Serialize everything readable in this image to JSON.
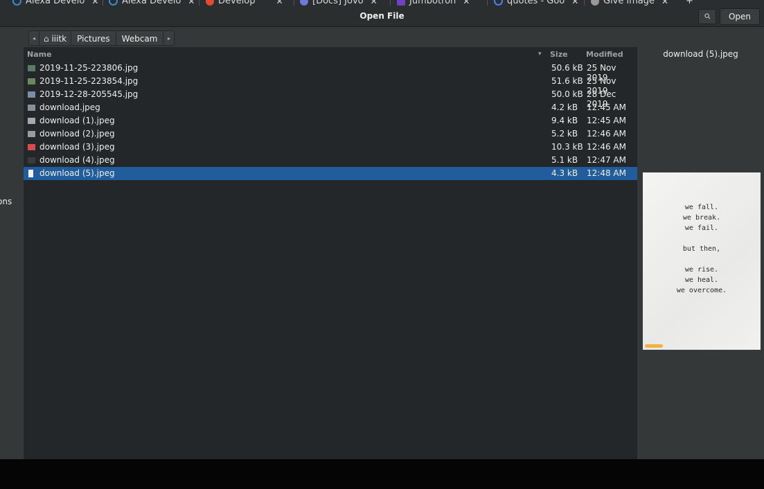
{
  "browser_tabs": [
    {
      "label": "Alexa Develo",
      "icon_color": "#2f8fd8"
    },
    {
      "label": "Alexa Develo",
      "icon_color": "#2f8fd8"
    },
    {
      "label": "Develop",
      "icon_color": "#e44a2e"
    },
    {
      "label": "[Docs] Jovo",
      "icon_color": "#6c7bd8"
    },
    {
      "label": "Jumbotron",
      "icon_color": "#6f42c1"
    },
    {
      "label": "quotes - Goo",
      "icon_color": "#4285f4"
    },
    {
      "label": "Give image",
      "icon_color": "#999999"
    }
  ],
  "dialog": {
    "title": "Open File",
    "search_icon": "search-icon",
    "open_label": "Open"
  },
  "sidebar": {
    "partial_label": "ons"
  },
  "pathbar": {
    "back_arrow": "◂",
    "home_icon": "⌂",
    "items": [
      "iiitk",
      "Pictures",
      "Webcam"
    ],
    "forward_arrow": "▸"
  },
  "columns": {
    "name": "Name",
    "sort_arrow": "▾",
    "size": "Size",
    "modified": "Modified"
  },
  "files": [
    {
      "name": "2019-11-25-223806.jpg",
      "size": "50.6 kB",
      "modified": "25 Nov 2019",
      "thumb": "#5c7a6a"
    },
    {
      "name": "2019-11-25-223854.jpg",
      "size": "51.6 kB",
      "modified": "25 Nov 2019",
      "thumb": "#6a8a5a"
    },
    {
      "name": "2019-12-28-205545.jpg",
      "size": "50.0 kB",
      "modified": "28 Dec 2019",
      "thumb": "#7a8ea8"
    },
    {
      "name": "download.jpeg",
      "size": "4.2 kB",
      "modified": "12:45 AM",
      "thumb": "#8a8f95"
    },
    {
      "name": "download (1).jpeg",
      "size": "9.4 kB",
      "modified": "12:45 AM",
      "thumb": "#a4a9b0"
    },
    {
      "name": "download (2).jpeg",
      "size": "5.2 kB",
      "modified": "12:46 AM",
      "thumb": "#9a9a9a"
    },
    {
      "name": "download (3).jpeg",
      "size": "10.3 kB",
      "modified": "12:46 AM",
      "thumb": "#d64b4b"
    },
    {
      "name": "download (4).jpeg",
      "size": "5.1 kB",
      "modified": "12:47 AM",
      "thumb": "#3a3a3a"
    },
    {
      "name": "download (5).jpeg",
      "size": "4.3 kB",
      "modified": "12:48 AM",
      "thumb": "#f2f2f2",
      "selected": true
    }
  ],
  "preview": {
    "filename": "download (5).jpeg",
    "quote_lines": [
      "we fall.",
      "we break.",
      "we fail.",
      "",
      "but then,",
      "",
      "we rise.",
      "we heal.",
      "we overcome."
    ]
  },
  "colors": {
    "selection": "#215d9c",
    "list_bg": "#232729",
    "panel_bg": "#353839"
  }
}
